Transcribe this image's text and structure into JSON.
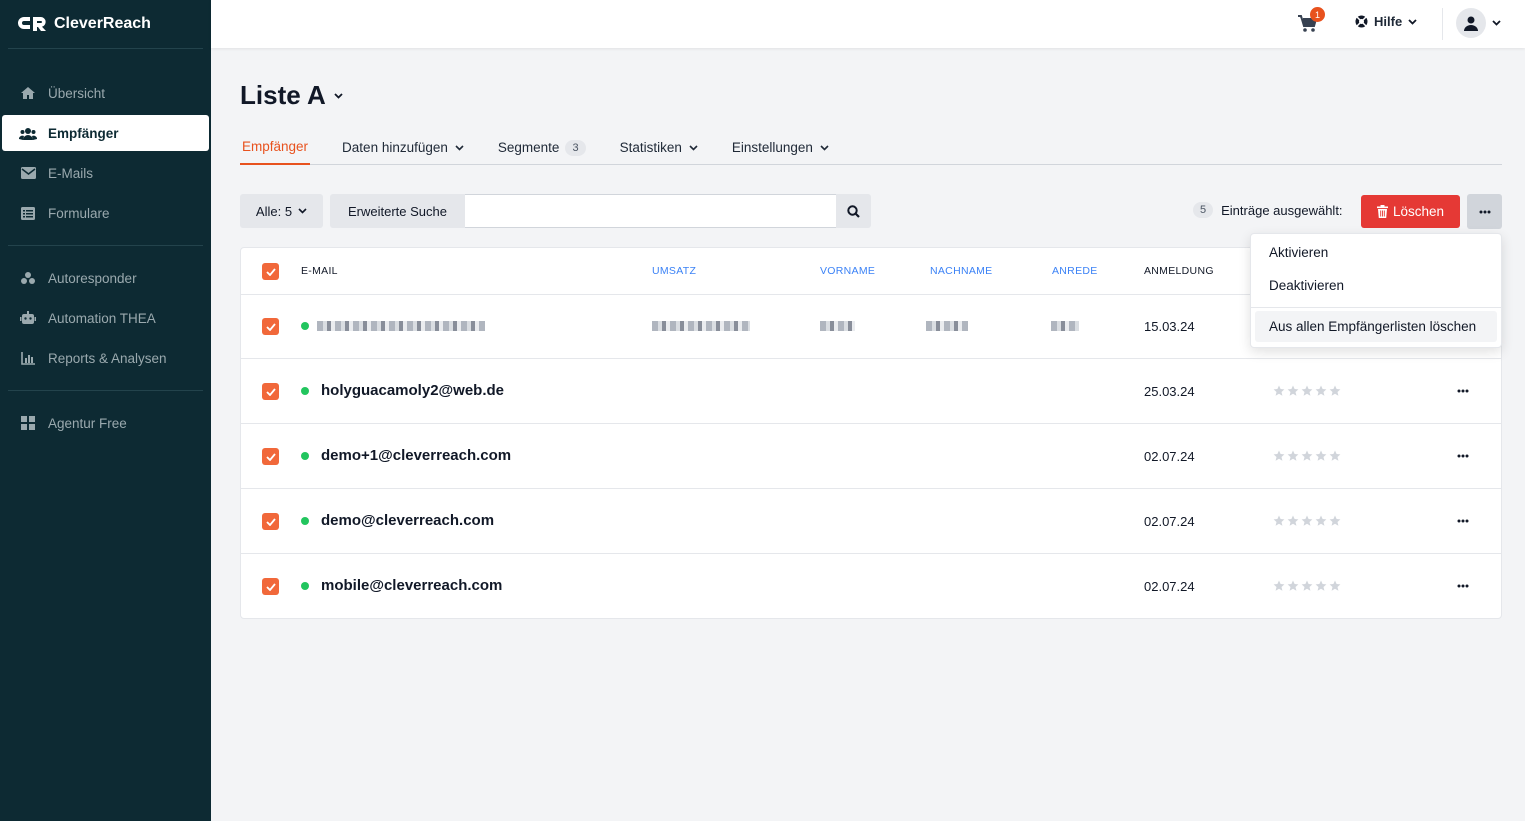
{
  "app": {
    "brand": "CleverReach"
  },
  "sidebar": {
    "items": [
      {
        "label": "Übersicht",
        "icon": "home-icon"
      },
      {
        "label": "Empfänger",
        "icon": "users-icon",
        "active": true
      },
      {
        "label": "E-Mails",
        "icon": "mail-icon"
      },
      {
        "label": "Formulare",
        "icon": "form-icon"
      },
      {
        "label": "Autoresponder",
        "icon": "robot-icon"
      },
      {
        "label": "Automation THEA",
        "icon": "automation-icon"
      },
      {
        "label": "Reports & Analysen",
        "icon": "chart-icon"
      },
      {
        "label": "Agentur Free",
        "icon": "grid-icon"
      }
    ]
  },
  "topbar": {
    "cart_count": "1",
    "help_label": "Hilfe"
  },
  "page": {
    "title": "Liste A"
  },
  "tabs": [
    {
      "label": "Empfänger",
      "active": true
    },
    {
      "label": "Daten hinzufügen"
    },
    {
      "label": "Segmente",
      "badge": "3"
    },
    {
      "label": "Statistiken"
    },
    {
      "label": "Einstellungen"
    }
  ],
  "toolbar": {
    "filter_label": "Alle: 5",
    "advanced_search_label": "Erweiterte Suche",
    "search_placeholder": "",
    "selected_count": "5",
    "selected_label": "Einträge ausgewählt:",
    "delete_label": "Löschen"
  },
  "table": {
    "headers": {
      "email": "E-MAIL",
      "umsatz": "UMSATZ",
      "vorname": "VORNAME",
      "nachname": "NACHNAME",
      "anrede": "ANREDE",
      "anmeldung": "ANMELDUNG"
    },
    "rows": [
      {
        "email": "",
        "date": "15.03.24",
        "redacted": true
      },
      {
        "email": "holyguacamoly2@web.de",
        "date": "25.03.24"
      },
      {
        "email": "demo+1@cleverreach.com",
        "date": "02.07.24"
      },
      {
        "email": "demo@cleverreach.com",
        "date": "02.07.24"
      },
      {
        "email": "mobile@cleverreach.com",
        "date": "02.07.24"
      }
    ]
  },
  "dropdown": {
    "items": [
      "Aktivieren",
      "Deaktivieren",
      "Aus allen Empfängerlisten löschen"
    ]
  },
  "colors": {
    "sidebar_bg": "#0d2a33",
    "accent": "#e8521e",
    "danger": "#e53935",
    "status_active": "#22c55e",
    "link": "#3b82f6"
  }
}
